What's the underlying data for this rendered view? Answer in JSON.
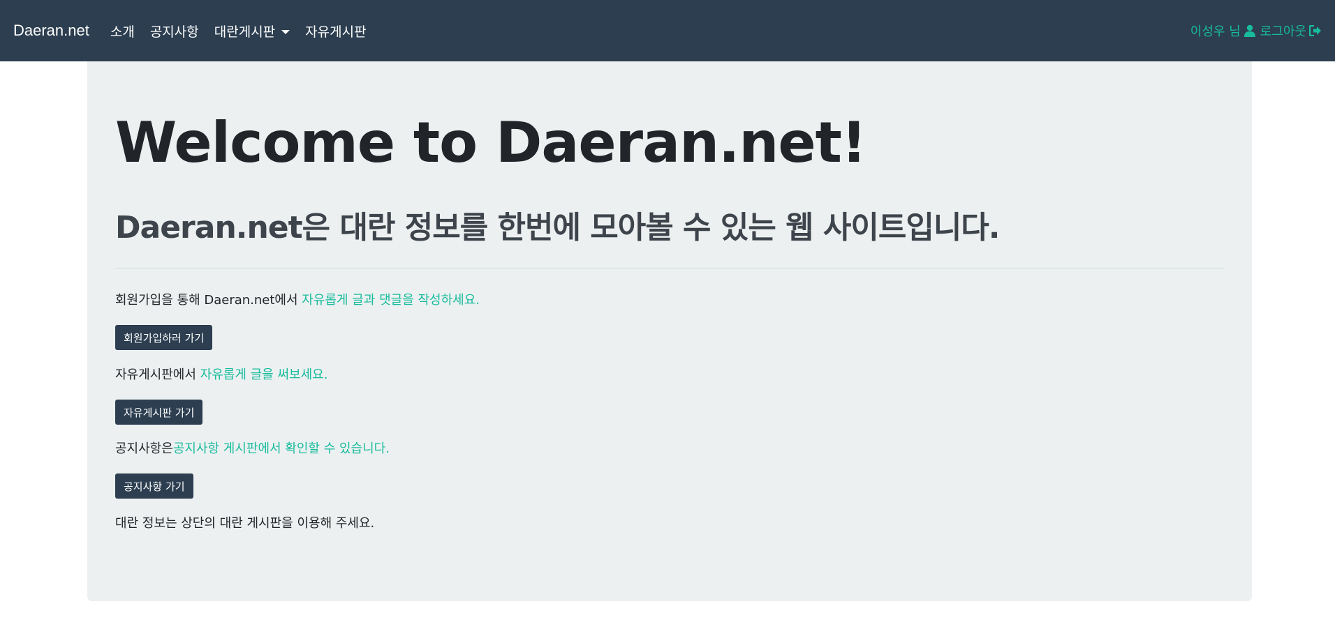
{
  "nav": {
    "brand": "Daeran.net",
    "links": {
      "intro": "소개",
      "notice": "공지사항",
      "daeran_board": "대란게시판",
      "free_board": "자유게시판"
    },
    "user_name": "이성우 님",
    "logout": "로그아웃",
    "icons": {
      "user": "user-icon",
      "logout": "sign-out-icon",
      "dropdown": "caret-down-icon"
    }
  },
  "colors": {
    "navbar": "#2c3e50",
    "accent": "#18bc9c",
    "jumbotron": "#ecf0f1",
    "button": "#2c3e50"
  },
  "main": {
    "title": "Welcome to Daeran.net!",
    "subtitle": "Daeran.net은 대란 정보를 한번에 모아볼 수 있는 웹 사이트입니다.",
    "signup_text": "회원가입을 통해 Daeran.net에서 ",
    "signup_accent": "자유롭게 글과 댓글을 작성하세요.",
    "signup_button": "회원가입하러 가기",
    "free_text": "자유게시판에서 ",
    "free_accent": "자유롭게 글을 써보세요.",
    "free_button": "자유게시판 가기",
    "notice_text": "공지사항은",
    "notice_accent": "공지사항 게시판에서 확인할 수 있습니다.",
    "notice_button": "공지사항 가기",
    "daeran_text": "대란 정보는 상단의 대란 게시판을 이용해 주세요."
  }
}
